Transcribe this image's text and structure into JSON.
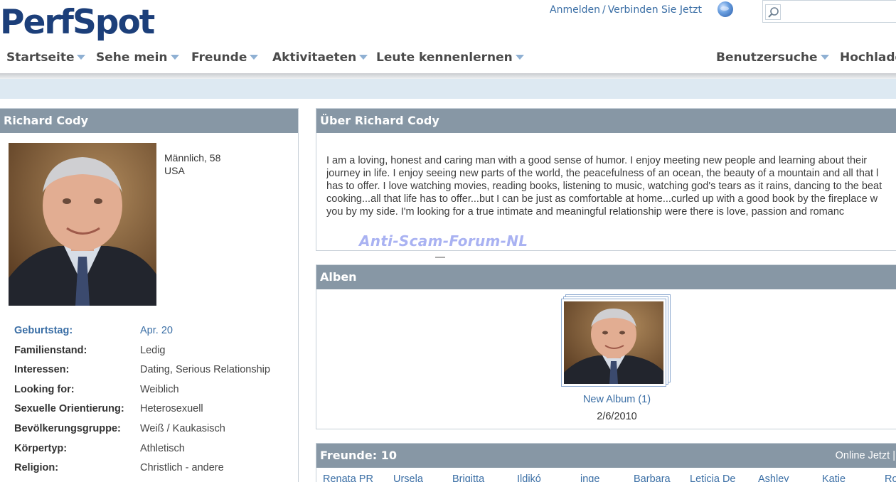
{
  "header": {
    "logo_text": "PerfSpot",
    "login_label": "Anmelden",
    "separator": "/",
    "join_label": "Verbinden Sie Jetzt",
    "search": {
      "placeholder": "",
      "value": ""
    }
  },
  "nav": {
    "items": [
      {
        "label": "Startseite"
      },
      {
        "label": "Sehe mein"
      },
      {
        "label": "Freunde"
      },
      {
        "label": "Aktivitaeten"
      },
      {
        "label": "Leute kennenlernen"
      },
      {
        "label": "Benutzersuche"
      },
      {
        "label": "Hochlade"
      }
    ]
  },
  "profile": {
    "name": "Richard Cody",
    "gender_age": "Männlich, 58",
    "country": "USA",
    "details": [
      {
        "label": "Geburtstag:",
        "value": "Apr. 20"
      },
      {
        "label": "Familienstand:",
        "value": "Ledig"
      },
      {
        "label": "Interessen:",
        "value": "Dating, Serious Relationship"
      },
      {
        "label": "Looking for:",
        "value": "Weiblich"
      },
      {
        "label": "Sexuelle Orientierung:",
        "value": "Heterosexuell"
      },
      {
        "label": "Bevölkerungsgruppe:",
        "value": "Weiß / Kaukasisch"
      },
      {
        "label": "Körpertyp:",
        "value": "Athletisch"
      },
      {
        "label": "Religion:",
        "value": "Christlich - andere"
      }
    ]
  },
  "about": {
    "title": "Über Richard Cody",
    "lines": [
      "I am a loving, honest and caring man with a good sense of humor. I enjoy meeting new people and learning about their",
      "journey in life. I enjoy seeing new parts of the world, the peacefulness of an ocean, the beauty of a mountain and all that l",
      "has to offer. I love watching movies, reading books, listening to music, watching god's tears as it rains, dancing to the beat",
      "cooking...all that life has to offer...but I can be just as comfortable at home...curled up with a good book by the fireplace w",
      "you by my side. I'm looking for a true intimate and meaningful relationship were there is love, passion and romanc"
    ]
  },
  "watermark": "Anti-Scam-Forum-NL",
  "albums": {
    "title": "Alben",
    "album_title": "New Album (1)",
    "album_date": "2/6/2010"
  },
  "friends": {
    "title": "Freunde: 10",
    "online_label": "Online Jetzt |",
    "names": [
      "Renata PR",
      "Ursela",
      "Brigitta",
      "Ildikó",
      "inge",
      "Barbara",
      "Leticia De",
      "Ashley",
      "Katie",
      "Ro"
    ]
  },
  "colors": {
    "logo": "#1c3f7a",
    "link": "#3a6ea5",
    "panel_header": "#8797a5",
    "subbar": "#dde9f2"
  }
}
